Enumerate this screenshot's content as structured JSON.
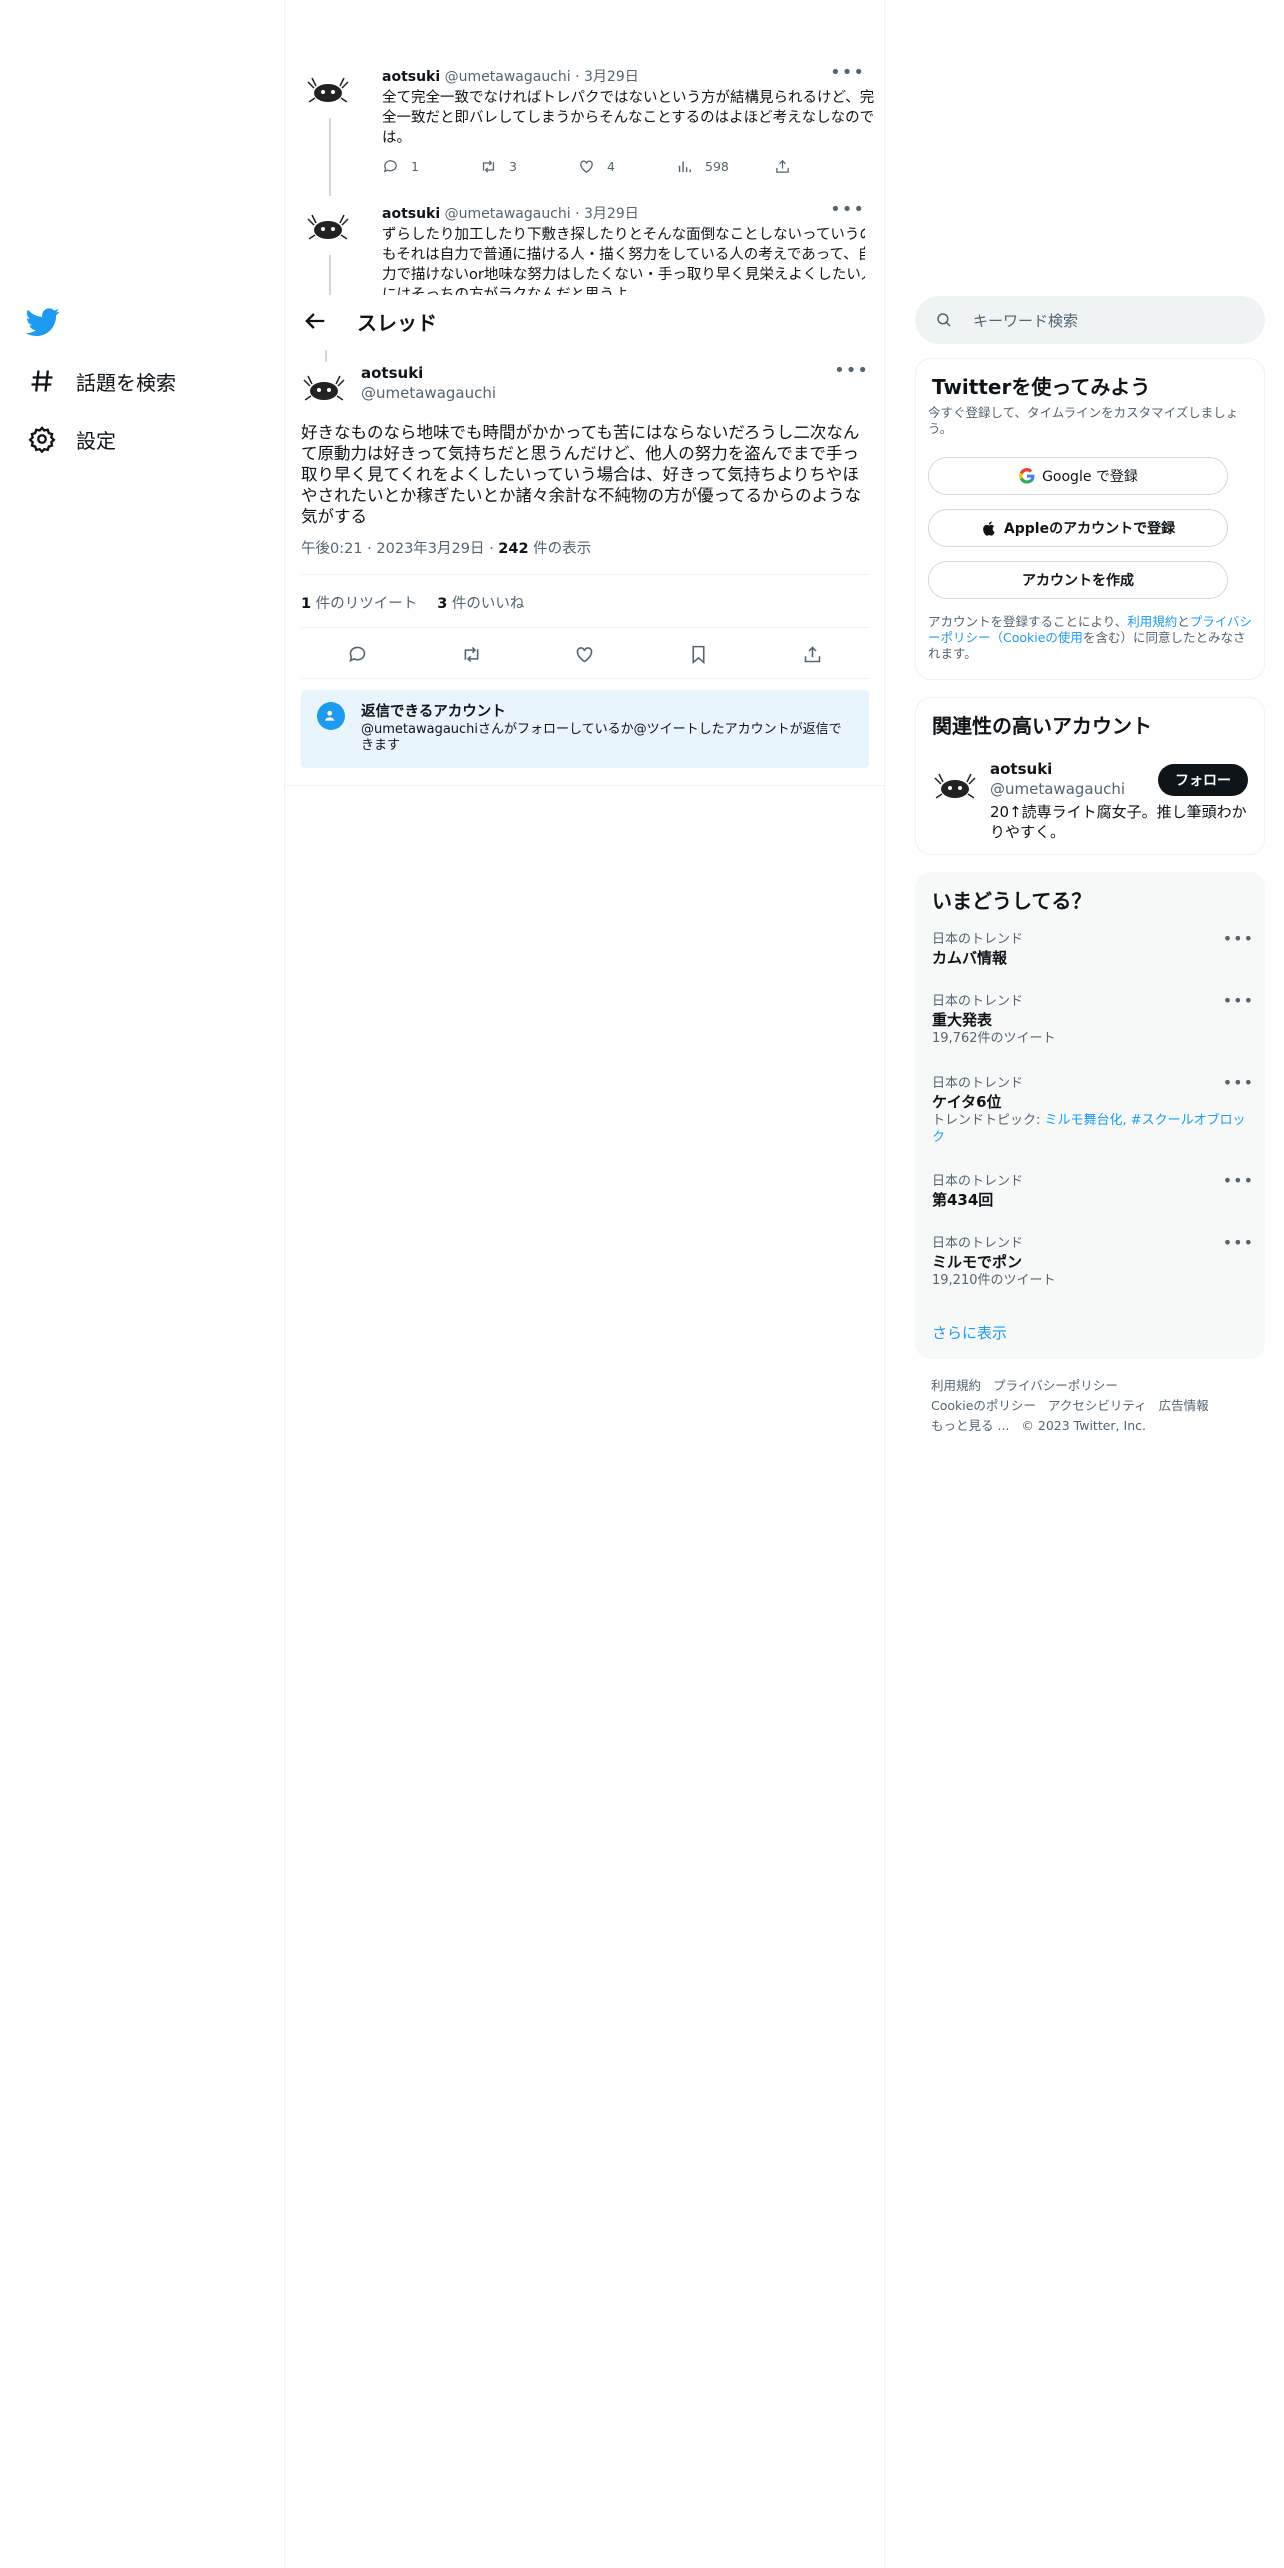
{
  "nav": {
    "explore_label": "話題を検索",
    "settings_label": "設定"
  },
  "bg_tweets": [
    {
      "name": "aotsuki",
      "handle": "@umetawagauchi",
      "date": "· 3月29日",
      "text": "全て完全一致でなければトレパクではないという方が結構見られるけど、完全一致だと即バレしてしまうからそんなことするのはよほど考えなしなのでは。",
      "replies": "1",
      "retweets": "3",
      "likes": "4",
      "views": "598"
    },
    {
      "name": "aotsuki",
      "handle": "@umetawagauchi",
      "date": "· 3月29日",
      "text": "ずらしたり加工したり下敷き探したりとそんな面倒なことしないっていうのもそれは自力で普通に描ける人・描く努力をしている人の考えであって、自力で描けないor地味な努力はしたくない・手っ取り早く見栄えよくしたい人にはそっちの方がラクなんだと思うよ。"
    }
  ],
  "thread_header": {
    "title": "スレッド"
  },
  "focus_tweet": {
    "name": "aotsuki",
    "handle": "@umetawagauchi",
    "text": "好きなものなら地味でも時間がかかっても苦にはならないだろうし二次なんて原動力は好きって気持ちだと思うんだけど、他人の努力を盗んでまで手っ取り早く見てくれをよくしたいっていう場合は、好きって気持ちよりちやほやされたいとか稼ぎたいとか諸々余計な不純物の方が優ってるからのような気がする",
    "time": "午後0:21 · 2023年3月29日 · ",
    "views_count": "242",
    "views_label": " 件の表示",
    "retweet_count": "1",
    "retweet_label": " 件のリツイート",
    "like_count": "3",
    "like_label": " 件のいいね"
  },
  "reply_restriction": {
    "title": "返信できるアカウント",
    "desc": "@umetawagauchiさんがフォローしているか@ツイートしたアカウントが返信できます"
  },
  "search": {
    "placeholder": "キーワード検索"
  },
  "signup": {
    "title": "Twitterを使ってみよう",
    "subtitle": "今すぐ登録して、タイムラインをカスタマイズしましょう。",
    "google_label": "Google で登録",
    "apple_label": "Appleのアカウントで登録",
    "create_label": "アカウントを作成",
    "terms_pre": "アカウントを登録することにより、",
    "terms_link1": "利用規約",
    "terms_mid1": "と",
    "terms_link2": "プライバシーポリシー（Cookieの使用",
    "terms_post": "を含む）に同意したとみなされます。"
  },
  "related": {
    "title": "関連性の高いアカウント",
    "name": "aotsuki",
    "handle": "@umetawagauchi",
    "bio": "20↑読専ライト腐女子。推し筆頭わかりやすく。",
    "follow_label": "フォロー"
  },
  "trends": {
    "title": "いまどうしてる？",
    "items": [
      {
        "category": "日本のトレンド",
        "topic": "カムバ情報",
        "count": ""
      },
      {
        "category": "日本のトレンド",
        "topic": "重大発表",
        "count": "19,762件のツイート"
      },
      {
        "category": "日本のトレンド",
        "topic": "ケイタ6位",
        "count": ""
      },
      {
        "category": "日本のトレンド",
        "topic": "第434回",
        "count": ""
      },
      {
        "category": "日本のトレンド",
        "topic": "ミルモでポン",
        "count": "19,210件のツイート"
      }
    ],
    "trend_topic_prefix": "トレンドトピック: ",
    "trend_topic_links": "ミルモ舞台化, #スクールオブロック",
    "show_more": "さらに表示"
  },
  "footer": {
    "terms": "利用規約",
    "privacy": "プライバシーポリシー",
    "cookie": "Cookieのポリシー",
    "accessibility": "アクセシビリティ",
    "ads": "広告情報",
    "more": "もっと見る ...",
    "copyright": "© 2023 Twitter, Inc."
  },
  "colors": {
    "brand": "#1d9bf0",
    "text": "#0f1419",
    "muted": "#536471"
  }
}
